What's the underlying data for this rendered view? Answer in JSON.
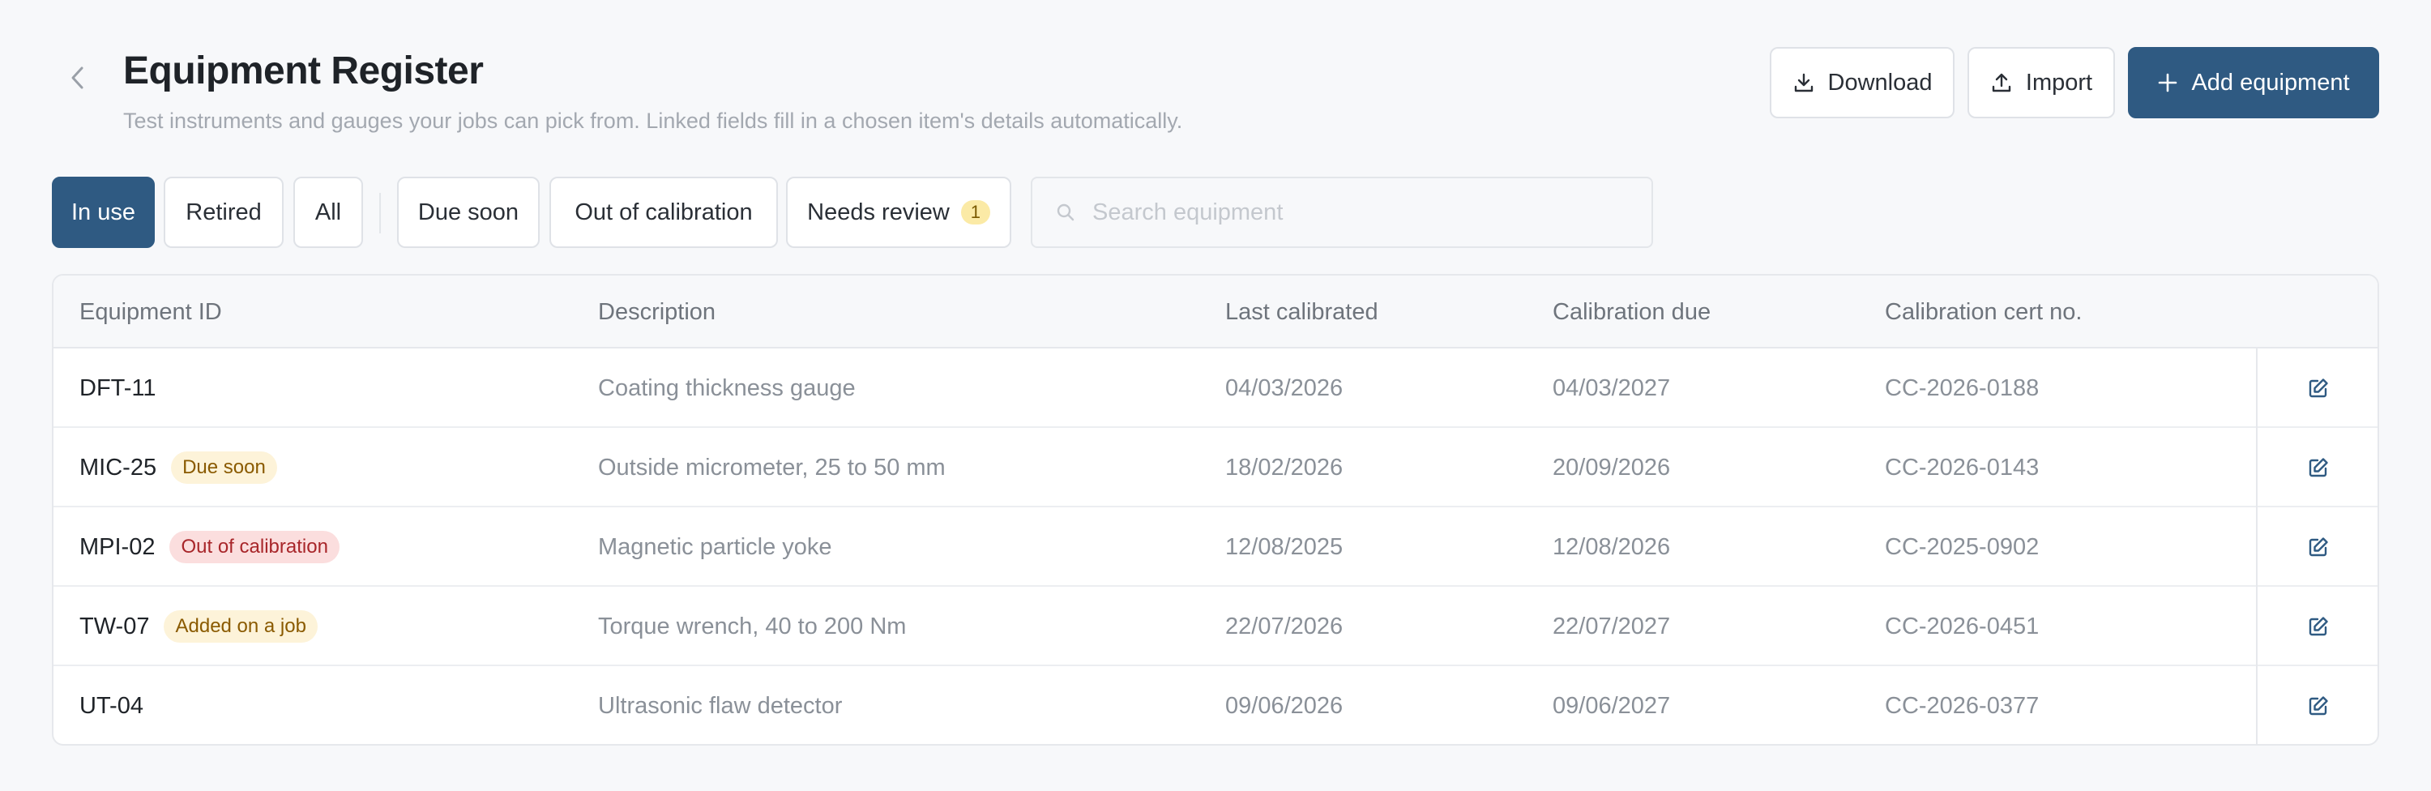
{
  "header": {
    "title": "Equipment Register",
    "subtitle": "Test instruments and gauges your jobs can pick from. Linked fields fill in a chosen item's details automatically.",
    "back_icon": "chevron-left-icon",
    "buttons": {
      "download": "Download",
      "import": "Import",
      "add": "Add equipment"
    }
  },
  "filters": {
    "status": [
      "In use",
      "Retired",
      "All"
    ],
    "active": "In use",
    "flags": [
      "Due soon",
      "Out of calibration",
      "Needs review"
    ],
    "needs_review_count": "1"
  },
  "search": {
    "placeholder": "Search equipment",
    "value": ""
  },
  "table": {
    "columns": [
      "Equipment ID",
      "Description",
      "Last calibrated",
      "Calibration due",
      "Calibration cert no."
    ],
    "rows": [
      {
        "id": "DFT-11",
        "badge": "",
        "description": "Coating thickness gauge",
        "last_calibrated": "04/03/2026",
        "calibration_due": "04/03/2027",
        "cert_no": "CC-2026-0188"
      },
      {
        "id": "MIC-25",
        "badge": "Due soon",
        "description": "Outside micrometer, 25 to 50 mm",
        "last_calibrated": "18/02/2026",
        "calibration_due": "20/09/2026",
        "cert_no": "CC-2026-0143"
      },
      {
        "id": "MPI-02",
        "badge": "Out of calibration",
        "description": "Magnetic particle yoke",
        "last_calibrated": "12/08/2025",
        "calibration_due": "12/08/2026",
        "cert_no": "CC-2025-0902"
      },
      {
        "id": "TW-07",
        "badge": "Added on a job",
        "description": "Torque wrench, 40 to 200 Nm",
        "last_calibrated": "22/07/2026",
        "calibration_due": "22/07/2027",
        "cert_no": "CC-2026-0451"
      },
      {
        "id": "UT-04",
        "badge": "",
        "description": "Ultrasonic flaw detector",
        "last_calibrated": "09/06/2026",
        "calibration_due": "09/06/2027",
        "cert_no": "CC-2026-0377"
      }
    ]
  },
  "colors": {
    "primary": "#2f5a82",
    "warn_bg": "#fdf3d9",
    "warn_text": "#8a5a00",
    "danger_bg": "#fbdede",
    "danger_text": "#a8262a"
  }
}
